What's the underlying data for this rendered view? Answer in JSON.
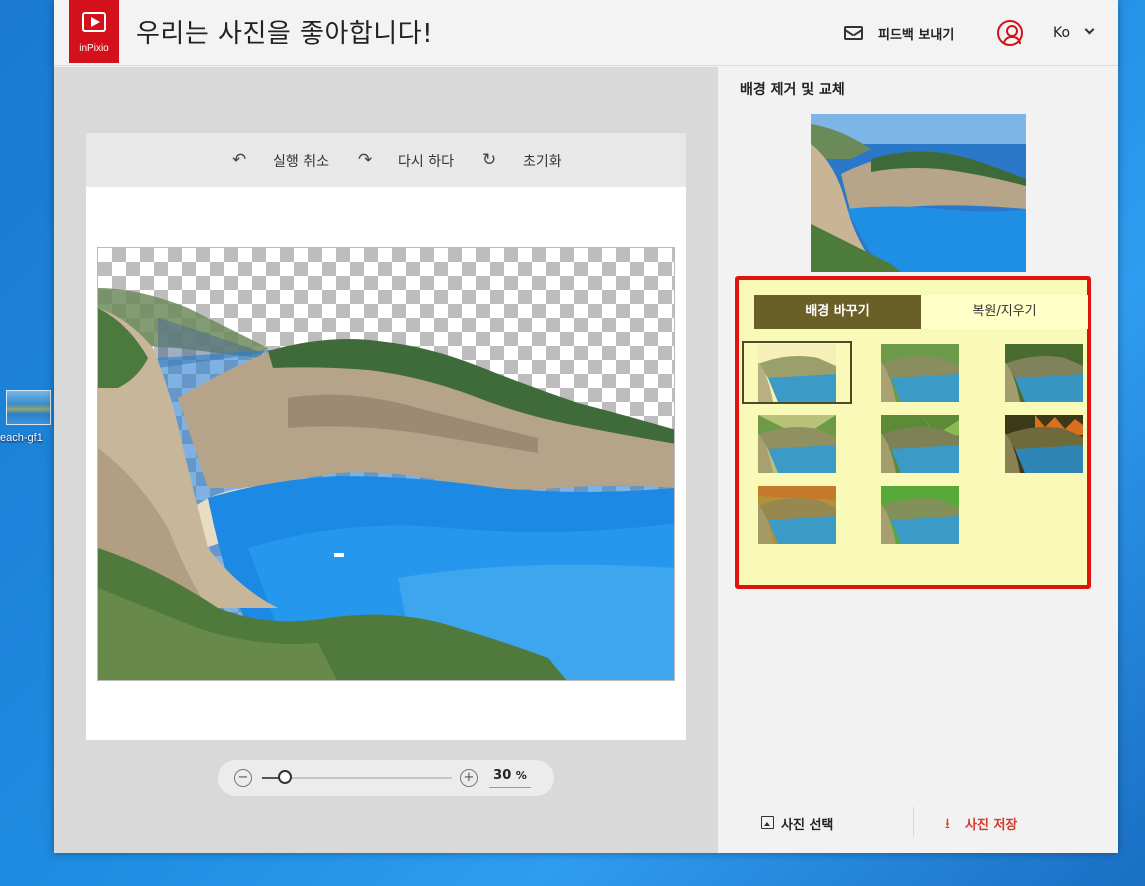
{
  "desktop": {
    "icon_caption": "each-gf1"
  },
  "header": {
    "brand": "inPixio",
    "title": "우리는 사진을 좋아합니다!",
    "feedback_label": "피드백 보내기",
    "language": "Ko"
  },
  "toolbar": {
    "undo_label": "실행 취소",
    "redo_label": "다시 하다",
    "reset_label": "초기화"
  },
  "zoom": {
    "value": "30",
    "unit": "%",
    "level": 0.12
  },
  "panel": {
    "title": "배경 제거 및 교체",
    "tabs": [
      {
        "label": "배경 바꾸기",
        "active": true
      },
      {
        "label": "복원/지우기",
        "active": false
      }
    ],
    "backgrounds": [
      {
        "name": "original",
        "selected": true
      },
      {
        "name": "green-blur-1",
        "selected": false
      },
      {
        "name": "dark-green",
        "selected": false
      },
      {
        "name": "palm-leaves",
        "selected": false
      },
      {
        "name": "foliage",
        "selected": false
      },
      {
        "name": "sunset-fire",
        "selected": false
      },
      {
        "name": "autumn",
        "selected": false
      },
      {
        "name": "bright-green",
        "selected": false
      }
    ],
    "select_photo_label": "사진 선택",
    "save_photo_label": "사진 저장"
  },
  "colors": {
    "accent": "#d4101a",
    "highlight_border": "#e0140f",
    "panel_highlight": "#fafab8",
    "active_tab": "#6a5f26"
  }
}
